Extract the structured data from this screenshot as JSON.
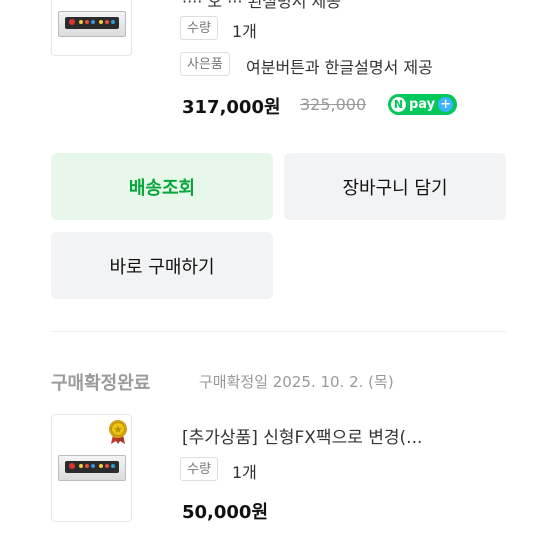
{
  "order1": {
    "title_partial": "···· 오 ··· 된설명서 제공",
    "qty_label": "수량",
    "qty_value": "1개",
    "gift_label": "사은품",
    "gift_value": "여분버튼과 한글설명서 제공",
    "price": "317,000원",
    "original_price": "325,000",
    "npay_label": "pay"
  },
  "actions": {
    "track_delivery": "배송조회",
    "add_to_cart": "장바구니 담기",
    "buy_now": "바로 구매하기"
  },
  "order2": {
    "status": "구매확정완료",
    "confirm_date": "구매확정일 2025. 10. 2. (목)",
    "title": "[추가상품] 신형FX팩으로 변경(...",
    "qty_label": "수량",
    "qty_value": "1개",
    "price": "50,000원"
  },
  "colors": {
    "green": "#07a63a",
    "npay_green": "#03c75a"
  }
}
